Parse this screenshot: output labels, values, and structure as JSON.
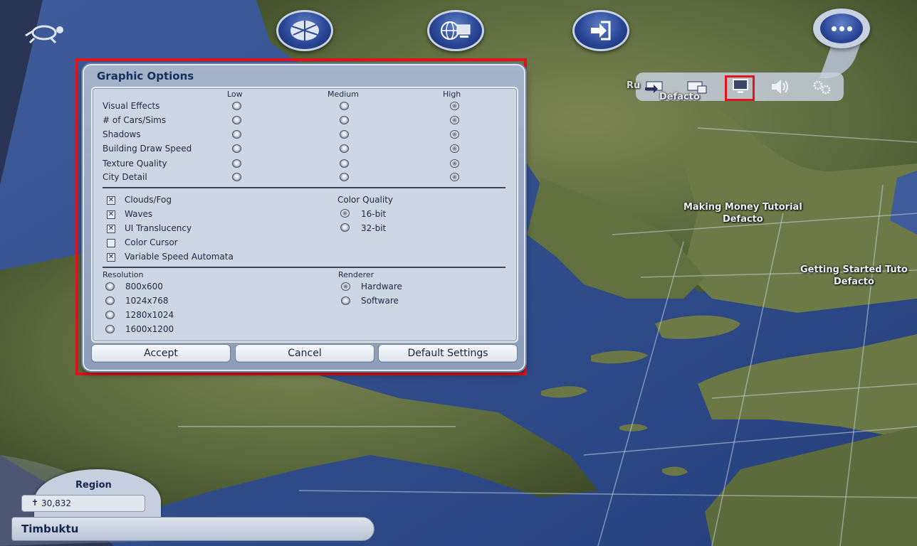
{
  "dialog": {
    "title": "Graphic Options",
    "columns": [
      "Low",
      "Medium",
      "High"
    ],
    "detail_rows": [
      {
        "label": "Visual Effects",
        "selected": "High"
      },
      {
        "label": "# of Cars/Sims",
        "selected": "High"
      },
      {
        "label": "Shadows",
        "selected": "High"
      },
      {
        "label": "Building Draw Speed",
        "selected": "High"
      },
      {
        "label": "Texture Quality",
        "selected": "High"
      },
      {
        "label": "City Detail",
        "selected": "High"
      }
    ],
    "checkboxes": [
      {
        "label": "Clouds/Fog",
        "checked": true
      },
      {
        "label": "Waves",
        "checked": true
      },
      {
        "label": "UI Translucency",
        "checked": true
      },
      {
        "label": "Color Cursor",
        "checked": false
      },
      {
        "label": "Variable Speed Automata",
        "checked": true
      }
    ],
    "color_quality": {
      "heading": "Color Quality",
      "options": [
        "16-bit",
        "32-bit"
      ],
      "selected": "16-bit"
    },
    "resolution": {
      "heading": "Resolution",
      "options": [
        "800x600",
        "1024x768",
        "1280x1024",
        "1600x1200"
      ],
      "selected": null
    },
    "renderer": {
      "heading": "Renderer",
      "options": [
        "Hardware",
        "Software"
      ],
      "selected": "Hardware"
    },
    "buttons": {
      "accept": "Accept",
      "cancel": "Cancel",
      "default": "Default Settings"
    }
  },
  "map_labels": [
    {
      "line1": "Making Money Tutorial",
      "line2": "Defacto"
    },
    {
      "line1": "Getting Started Tuto",
      "line2": "Defacto"
    },
    {
      "line1": "Ru",
      "line2": "Defacto"
    }
  ],
  "top_buttons": [
    "region-view-icon",
    "online-globe-icon",
    "exit-icon"
  ],
  "options_strip_icons": [
    "load-game-icon",
    "save-game-icon",
    "graphics-options-icon",
    "audio-options-icon",
    "game-settings-icon"
  ],
  "region": {
    "title": "Region",
    "population": "30,832",
    "name": "Timbuktu"
  },
  "colors": {
    "highlight": "#e0141c",
    "dialog_bg": "#a4b3c9",
    "panel_bg": "#cdd6e3",
    "water": "#2c4a86",
    "land": "#5d6c3c"
  }
}
